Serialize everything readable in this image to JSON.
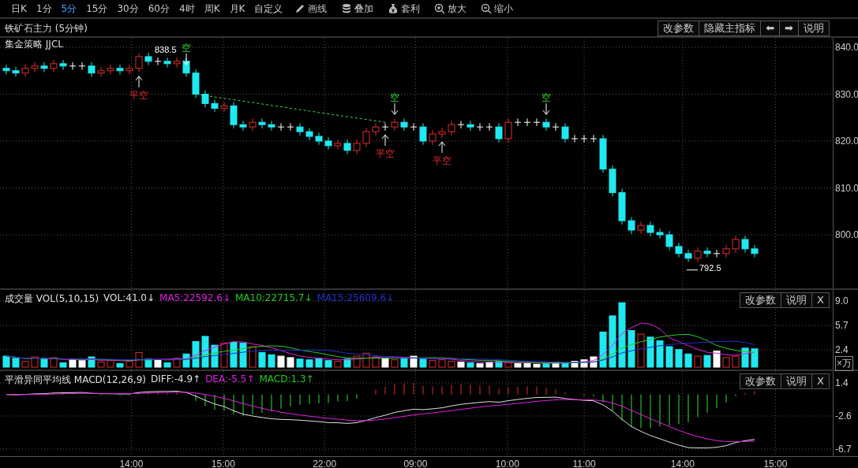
{
  "toolbar": {
    "periods": [
      {
        "label": "日K",
        "selected": false
      },
      {
        "label": "1分",
        "selected": false
      },
      {
        "label": "5分",
        "selected": true
      },
      {
        "label": "15分",
        "selected": false
      },
      {
        "label": "30分",
        "selected": false
      },
      {
        "label": "60分",
        "selected": false
      },
      {
        "label": "4时",
        "selected": false
      },
      {
        "label": "周K",
        "selected": false
      },
      {
        "label": "月K",
        "selected": false
      },
      {
        "label": "自定义",
        "selected": false
      }
    ],
    "tools": [
      {
        "label": "画线",
        "kind": "pencil"
      },
      {
        "label": "叠加",
        "kind": "stack"
      },
      {
        "label": "套利",
        "kind": "bag"
      },
      {
        "label": "放大",
        "kind": "zoomin"
      },
      {
        "label": "缩小",
        "kind": "zoomout"
      }
    ]
  },
  "main": {
    "title": "铁矿石主力 (5分钟)",
    "buttons": [
      "改参数",
      "隐藏主指标",
      "⬅",
      "➡",
      "说明"
    ],
    "indicator": "集金策略 JJCL",
    "axis": [
      "840.0",
      "830.0",
      "820.0",
      "810.0",
      "800.0"
    ],
    "signals": [
      {
        "text": "平空",
        "kind": "close"
      },
      {
        "text": "空",
        "kind": "open"
      },
      {
        "text": "平空",
        "kind": "close"
      },
      {
        "text": "空",
        "kind": "open"
      },
      {
        "text": "平空",
        "kind": "close"
      },
      {
        "text": "空",
        "kind": "open"
      }
    ],
    "price_labels": [
      "838.5",
      "792.5"
    ]
  },
  "volume": {
    "items": [
      {
        "text": "成交量 VOL(5,10,15)",
        "color": "#e0e0e0"
      },
      {
        "text": "VOL:41.0↓",
        "color": "#e0e0e0"
      },
      {
        "text": "MA5:22592.6↓",
        "color": "#e020e0"
      },
      {
        "text": "MA10:22715.7↓",
        "color": "#20d020"
      },
      {
        "text": "MA15:25609.6↓",
        "color": "#2030d0"
      }
    ],
    "buttons": [
      "改参数",
      "说明",
      "X"
    ],
    "axis": [
      "9.0",
      "5.7",
      "2.4"
    ],
    "unit": "×万"
  },
  "macd": {
    "items": [
      {
        "text": "平滑异同平均线 MACD(12,26,9)",
        "color": "#e0e0e0"
      },
      {
        "text": "DIFF:-4.9↑",
        "color": "#e0e0e0"
      },
      {
        "text": "DEA:-5.5↑",
        "color": "#e020e0"
      },
      {
        "text": "MACD:1.3↑",
        "color": "#20d020"
      }
    ],
    "buttons": [
      "改参数",
      "说明",
      "X"
    ],
    "axis": [
      "1.4",
      "-2.6",
      "-6.7"
    ]
  },
  "time_axis": [
    "14:00",
    "15:00",
    "22:00",
    "09:00",
    "10:00",
    "11:00",
    "14:00",
    "15:00"
  ]
}
